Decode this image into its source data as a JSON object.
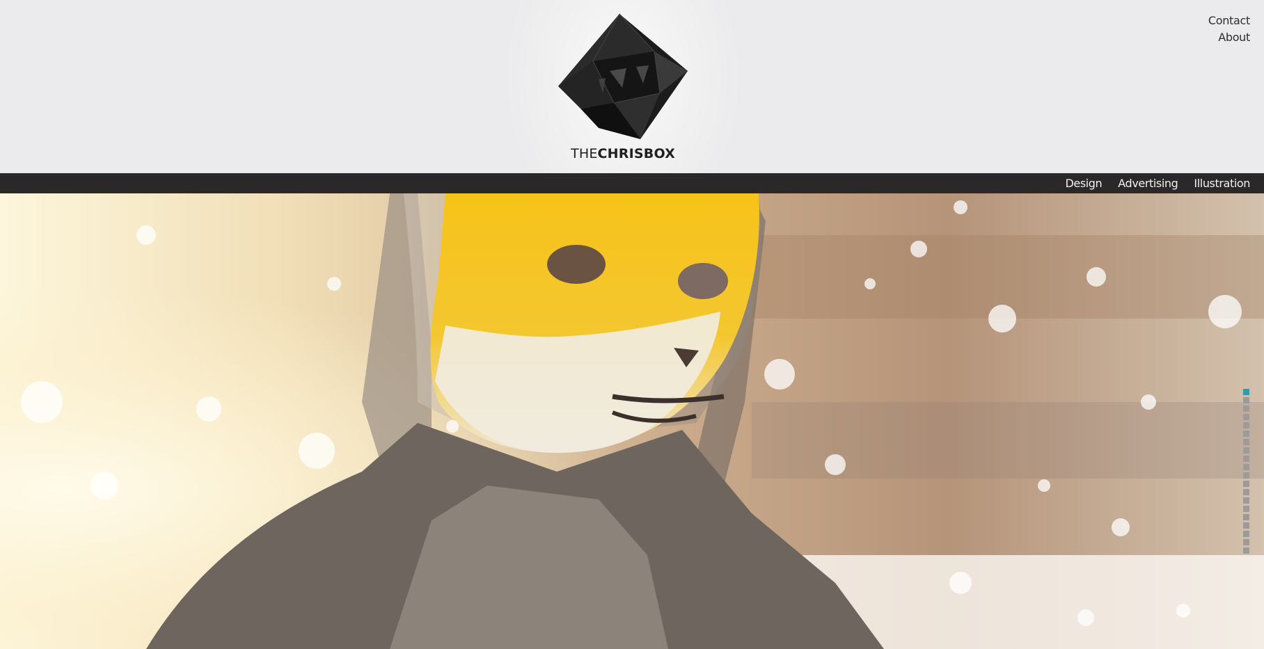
{
  "header": {
    "brand_prefix": "THE",
    "brand_name": "CHRISBOX",
    "logo_icon": "faceted-black-cube-logo"
  },
  "top_links": [
    {
      "label": "Contact"
    },
    {
      "label": "About"
    }
  ],
  "nav": {
    "items": [
      {
        "label": "Design"
      },
      {
        "label": "Advertising"
      },
      {
        "label": "Illustration"
      }
    ]
  },
  "hero": {
    "image": "person-in-hood-wearing-yellow-fox-mask-with-feathers",
    "mask_color": "#f6c21b"
  },
  "slideshow": {
    "total_slides": 20,
    "active_index": 0,
    "active_color": "#2b9cb4",
    "inactive_color": "#9b9b9b"
  },
  "colors": {
    "header_bg": "#ececec",
    "navbar_bg": "#2a2829",
    "nav_text": "#f2f2f2"
  }
}
